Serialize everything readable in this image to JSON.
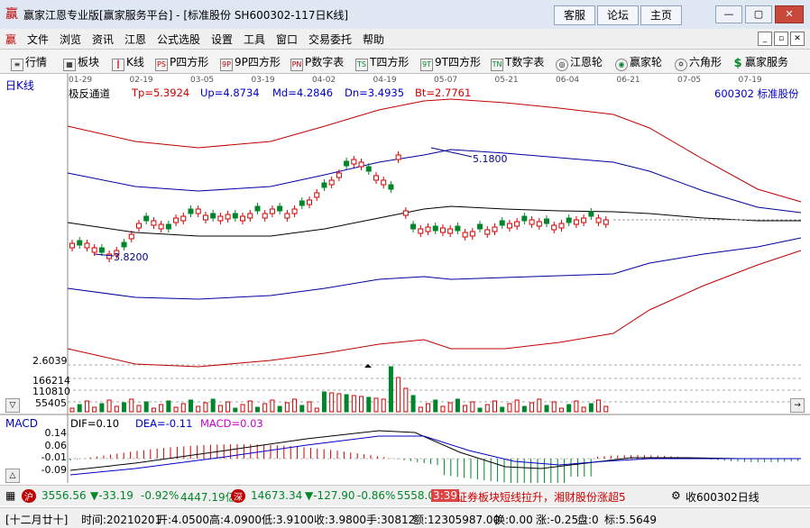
{
  "window": {
    "title": "赢家江恩专业版[赢家服务平台] - [标准股份  SH600302-117日K线]",
    "buttons": [
      "客服",
      "论坛",
      "主页"
    ],
    "controls": [
      "—",
      "▢",
      "✕"
    ]
  },
  "menu": {
    "items": [
      "文件",
      "浏览",
      "资讯",
      "江恩",
      "公式选股",
      "设置",
      "工具",
      "窗口",
      "交易委托",
      "帮助"
    ],
    "mdi_controls": [
      "_",
      "▫",
      "✕"
    ]
  },
  "toolbar": {
    "items": [
      {
        "icon": "list-icon",
        "glyph": "≡",
        "label": "行情"
      },
      {
        "icon": "grid-icon",
        "glyph": "▦",
        "label": "板块"
      },
      {
        "icon": "candlestick-icon",
        "glyph": "┃",
        "label": "K线"
      },
      {
        "icon": "ps-icon",
        "glyph": "PS",
        "label": "P四方形"
      },
      {
        "icon": "9p-icon",
        "glyph": "9P",
        "label": "9P四方形"
      },
      {
        "icon": "pn-icon",
        "glyph": "PN",
        "label": "P数字表"
      },
      {
        "icon": "ts-icon",
        "glyph": "TS",
        "label": "T四方形"
      },
      {
        "icon": "9t-icon",
        "glyph": "9T",
        "label": "9T四方形"
      },
      {
        "icon": "tn-icon",
        "glyph": "TN",
        "label": "T数字表"
      },
      {
        "icon": "wheel-icon",
        "glyph": "◎",
        "label": "江恩轮"
      },
      {
        "icon": "win-wheel-icon",
        "glyph": "◉",
        "label": "赢家轮"
      },
      {
        "icon": "hexagon-icon",
        "glyph": "✡",
        "label": "六角形"
      },
      {
        "icon": "dollar-icon",
        "glyph": "$",
        "label": "赢家服务"
      }
    ]
  },
  "chart": {
    "period_label": "日K线",
    "indicator_name": "极反通道",
    "tp": "Tp=5.3924",
    "up": "Up=4.8734",
    "md": "Md=4.2846",
    "dn": "Dn=3.4935",
    "bt": "Bt=2.7761",
    "stock": "600302 标准股份",
    "dates": [
      "01-29",
      "02-19",
      "03-05",
      "03-19",
      "04-02",
      "04-19",
      "05-07",
      "05-21",
      "06-04",
      "06-21",
      "07-05",
      "07-19"
    ],
    "high_label": "5.1800",
    "low_label": "3.8200",
    "volume_labels": [
      "2.6039",
      "166214",
      "110810",
      "55405"
    ],
    "macd_title": "MACD",
    "dif": "DIF=0.10",
    "dea": "DEA=-0.11",
    "macd": "MACD=0.03",
    "macd_scale": [
      "0.14",
      "0.06",
      "-0.01",
      "-0.09"
    ],
    "colors": {
      "up": "#d00000",
      "down": "#00862a",
      "channel_outer": "#c00000",
      "channel_inner": "#0000a0",
      "mid": "#000000"
    }
  },
  "status": {
    "index1": "3556.56",
    "index1_change": "▼-33.19",
    "index1_pct": "-0.92%",
    "index1_amount": "4447.19亿",
    "index2": "14673.34",
    "index2_change": "▼-127.90",
    "index2_pct": "-0.86%",
    "index2_amount": "5558.0",
    "time": "3:39",
    "news": "证券板块短线拉升，湘财股份涨超5",
    "side_label": "收600302日线"
  },
  "bar": {
    "lunar": "[十二月廿十]",
    "date": "时间:20210201",
    "open": "开:4.0500",
    "high": "高:4.0900",
    "low": "低:3.9100",
    "close": "收:3.9800",
    "hand": "手:30812",
    "amount": "额:12305987.00",
    "turnover": "换:0.00",
    "change": "涨:-0.25",
    "pan": "盘:0",
    "biao": "标:5.5649"
  }
}
